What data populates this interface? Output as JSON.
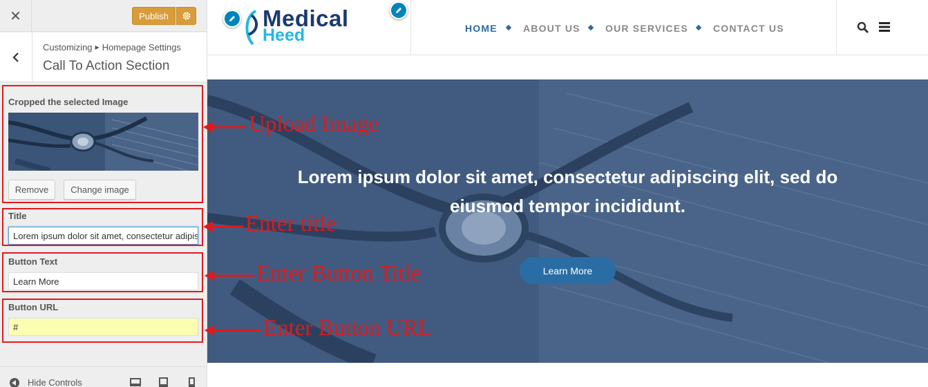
{
  "customizer": {
    "close_icon": "close-icon",
    "publish_label": "Publish",
    "breadcrumb_root": "Customizing",
    "breadcrumb_parent": "Homepage Settings",
    "section_title": "Call To Action Section",
    "image_label": "Cropped the selected Image",
    "remove_label": "Remove",
    "change_label": "Change image",
    "title_label": "Title",
    "title_value": "Lorem ipsum dolor sit amet, consectetur adipiscing elit, sed do eiusmod tempor incididunt.",
    "button_text_label": "Button Text",
    "button_text_value": "Learn More",
    "button_url_label": "Button URL",
    "button_url_value": "#",
    "hide_controls_label": "Hide Controls",
    "accent_color": "#d89c3a"
  },
  "site": {
    "logo_top": "Medical",
    "logo_bottom": "Heed",
    "nav": [
      {
        "label": "HOME",
        "active": true
      },
      {
        "label": "ABOUT US",
        "active": false
      },
      {
        "label": "OUR SERVICES",
        "active": false
      },
      {
        "label": "CONTACT US",
        "active": false
      }
    ],
    "hero_text": "Lorem ipsum dolor sit amet, consectetur adipiscing elit, sed do eiusmod tempor incididunt.",
    "hero_button": "Learn More",
    "nav_active_color": "#2d6a9f",
    "brand_color": "#1b3a6f",
    "brand_accent": "#21b8e6"
  },
  "annotations": [
    {
      "text": "Upload Image"
    },
    {
      "text": "Enter title"
    },
    {
      "text": "Enter Button Title"
    },
    {
      "text": "Enter Button URL"
    }
  ],
  "annotation_color": "#e0191c"
}
